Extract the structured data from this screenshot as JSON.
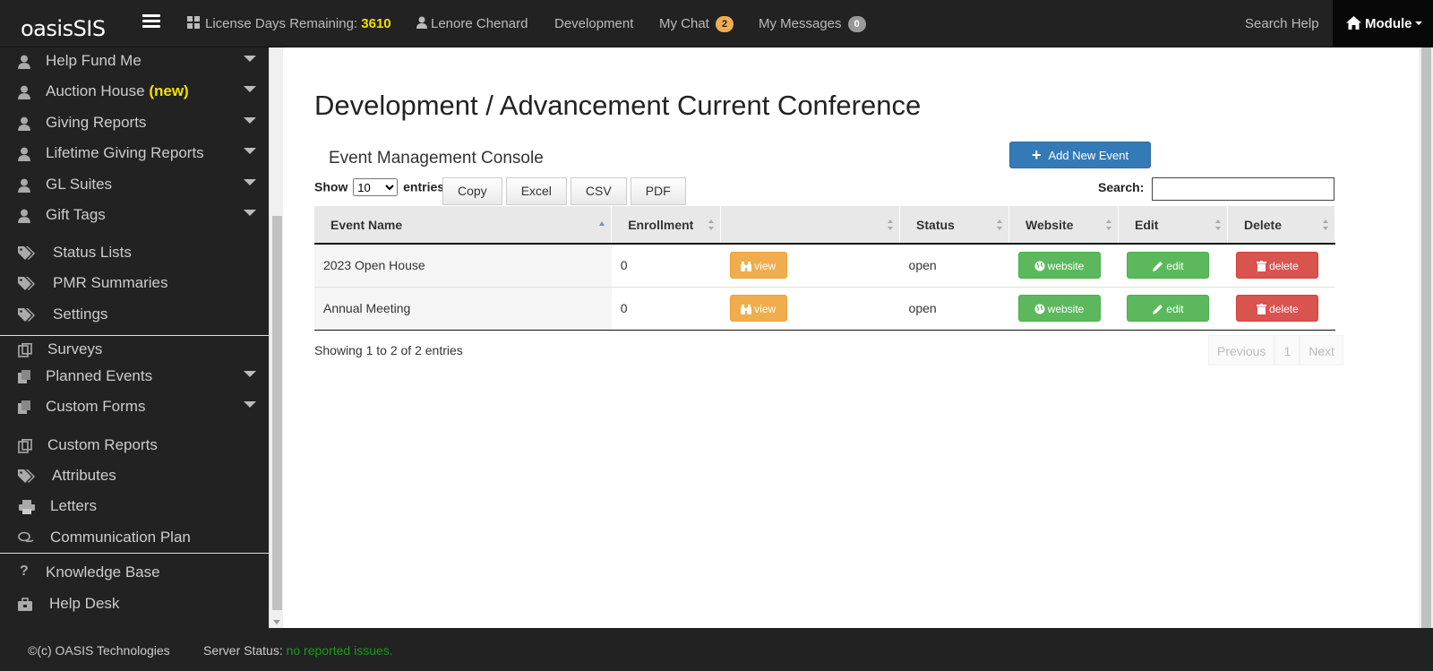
{
  "header": {
    "brand": "oasisSIS",
    "license_label": "License Days Remaining:",
    "license_days": "3610",
    "user_name": "Lenore Chenard",
    "section": "Development",
    "chat_label": "My Chat",
    "chat_count": "2",
    "messages_label": "My Messages",
    "messages_count": "0",
    "search_help": "Search Help",
    "module_label": "Module"
  },
  "sidebar": {
    "items": [
      {
        "label": "Help Fund Me",
        "icon": "user-icon"
      },
      {
        "label": "Auction House",
        "new": "(new)",
        "icon": "user-icon"
      },
      {
        "label": "Giving Reports",
        "icon": "user-icon"
      },
      {
        "label": "Lifetime Giving Reports",
        "icon": "user-icon"
      },
      {
        "label": "GL Suites",
        "icon": "user-icon"
      },
      {
        "label": "Gift Tags",
        "icon": "user-icon"
      },
      {
        "label": "Status Lists",
        "icon": "tags-icon"
      },
      {
        "label": "PMR Summaries",
        "icon": "tags-icon"
      },
      {
        "label": "Settings",
        "icon": "tags-icon"
      },
      {
        "label": "Surveys",
        "icon": "copy-icon"
      },
      {
        "label": "Planned Events",
        "icon": "files-icon"
      },
      {
        "label": "Custom Forms",
        "icon": "files-icon"
      },
      {
        "label": "Custom Reports",
        "icon": "copy-icon"
      },
      {
        "label": "Attributes",
        "icon": "tags-icon"
      },
      {
        "label": "Letters",
        "icon": "print-icon"
      },
      {
        "label": "Communication Plan",
        "icon": "comments-icon"
      },
      {
        "label": "Knowledge Base",
        "icon": "question-icon"
      },
      {
        "label": "Help Desk",
        "icon": "briefcase-icon"
      }
    ]
  },
  "main": {
    "title": "Development / Advancement Current Conference",
    "console_title": "Event Management Console",
    "add_button": "Add New Event",
    "show_label": "Show",
    "entries_value": "10",
    "entries_label": "entries",
    "export_buttons": [
      "Copy",
      "Excel",
      "CSV",
      "PDF"
    ],
    "search_label": "Search:",
    "search_value": "",
    "columns": [
      "Event Name",
      "Enrollment",
      "",
      "Status",
      "Website",
      "Edit",
      "Delete"
    ],
    "rows": [
      {
        "name": "2023 Open House",
        "enrollment": "0",
        "view": "view",
        "status": "open",
        "website": "website",
        "edit": "edit",
        "delete": "delete"
      },
      {
        "name": "Annual Meeting",
        "enrollment": "0",
        "view": "view",
        "status": "open",
        "website": "website",
        "edit": "edit",
        "delete": "delete"
      }
    ],
    "info": "Showing 1 to 2 of 2 entries",
    "pager": {
      "previous": "Previous",
      "page": "1",
      "next": "Next"
    }
  },
  "footer": {
    "copyright": "©(c) OASIS Technologies",
    "server_status_label": "Server Status:",
    "server_status_value": "no reported issues."
  },
  "colors": {
    "topbar": "#222222",
    "accent_yellow": "#f0e000",
    "primary": "#337ab7",
    "warning": "#f0ad4e",
    "success": "#5cb85c",
    "danger": "#d9534f",
    "status_ok": "#1a9a1a"
  }
}
